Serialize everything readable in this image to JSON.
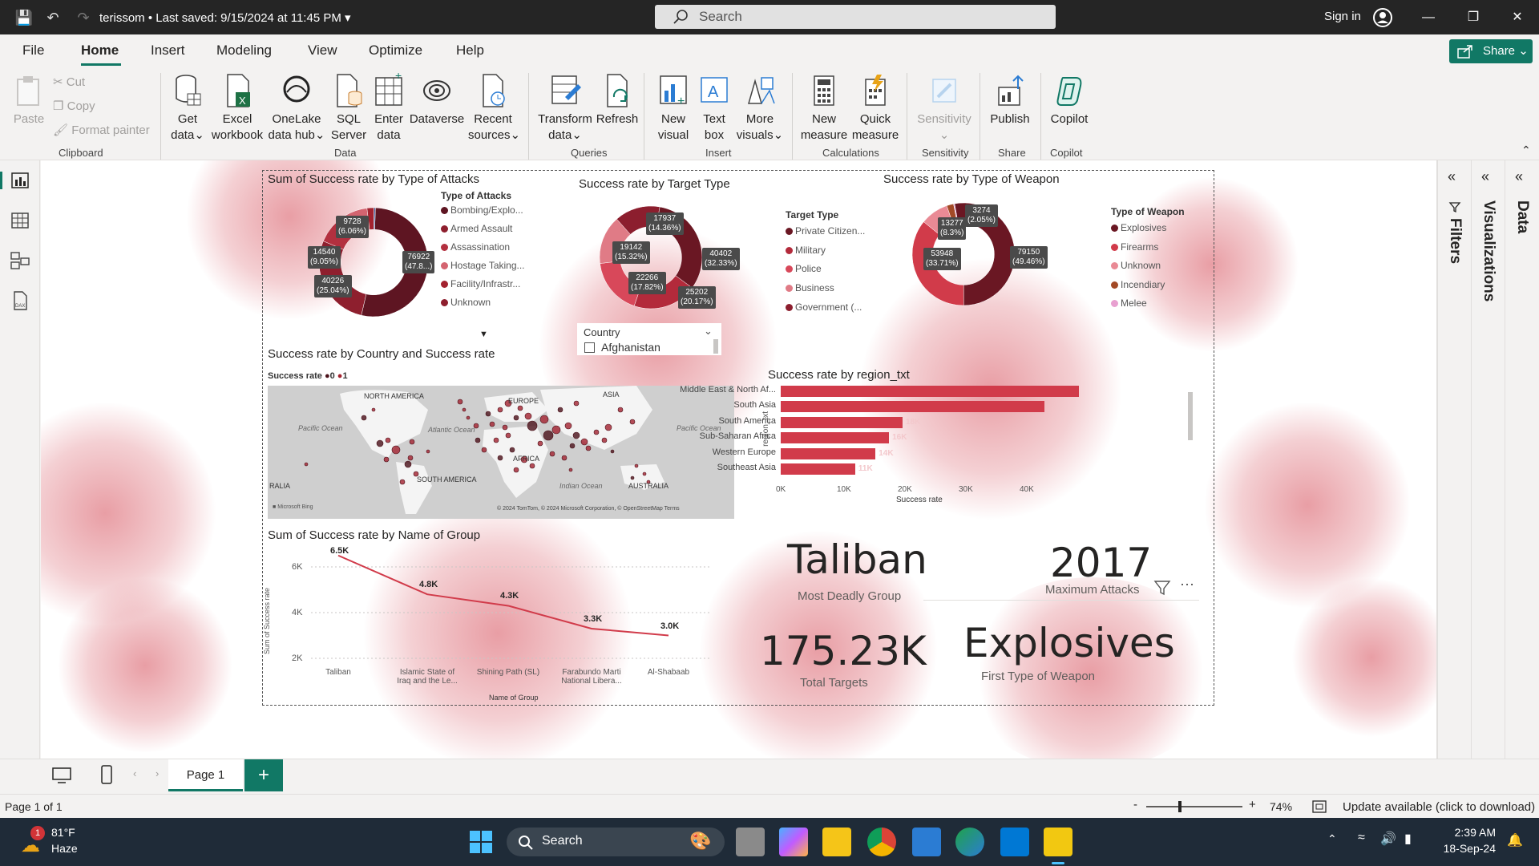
{
  "titlebar": {
    "filename": "terissom",
    "saved": "Last saved: 9/15/2024 at 11:45 PM",
    "search_placeholder": "Search",
    "signin": "Sign in"
  },
  "menu": {
    "tabs": [
      "File",
      "Home",
      "Insert",
      "Modeling",
      "View",
      "Optimize",
      "Help"
    ],
    "share": "Share"
  },
  "ribbon": {
    "clipboard": {
      "paste": "Paste",
      "cut": "Cut",
      "copy": "Copy",
      "format_painter": "Format painter",
      "group": "Clipboard"
    },
    "data": {
      "get_data": [
        "Get",
        "data"
      ],
      "excel": [
        "Excel",
        "workbook"
      ],
      "onelake": [
        "OneLake",
        "data hub"
      ],
      "sql": [
        "SQL",
        "Server"
      ],
      "enter": [
        "Enter",
        "data"
      ],
      "dataverse": "Dataverse",
      "recent": [
        "Recent",
        "sources"
      ],
      "group": "Data"
    },
    "queries": {
      "transform": [
        "Transform",
        "data"
      ],
      "refresh": "Refresh",
      "group": "Queries"
    },
    "insert": {
      "new_visual": [
        "New",
        "visual"
      ],
      "text_box": [
        "Text",
        "box"
      ],
      "more_visuals": [
        "More",
        "visuals"
      ],
      "group": "Insert"
    },
    "calculations": {
      "new_measure": [
        "New",
        "measure"
      ],
      "quick_measure": [
        "Quick",
        "measure"
      ],
      "group": "Calculations"
    },
    "sensitivity": {
      "label": "Sensitivity",
      "group": "Sensitivity"
    },
    "share": {
      "publish": "Publish",
      "group": "Share"
    },
    "copilot": {
      "label": "Copilot",
      "group": "Copilot"
    }
  },
  "visuals": {
    "attacks_donut": {
      "title": "Sum of Success rate by Type of Attacks",
      "legend_title": "Type of Attacks",
      "legend": [
        "Bombing/Explo...",
        "Armed Assault",
        "Assassination",
        "Hostage Taking...",
        "Facility/Infrastr...",
        "Unknown"
      ],
      "labels": [
        [
          "9728",
          "(6.06%)"
        ],
        [
          "14540",
          "(9.05%)"
        ],
        [
          "76922",
          "(47.8...)"
        ],
        [
          "40226",
          "(25.04%)"
        ]
      ]
    },
    "target_donut": {
      "title": "Success rate by Target Type",
      "legend_title": "Target Type",
      "legend": [
        "Private Citizen...",
        "Military",
        "Police",
        "Business",
        "Government (..."
      ],
      "labels": [
        [
          "17937",
          "(14.36%)"
        ],
        [
          "19142",
          "(15.32%)"
        ],
        [
          "40402",
          "(32.33%)"
        ],
        [
          "22266",
          "(17.82%)"
        ],
        [
          "25202",
          "(20.17%)"
        ]
      ]
    },
    "weapon_donut": {
      "title": "Success rate by Type of Weapon",
      "legend_title": "Type of Weapon",
      "legend": [
        "Explosives",
        "Firearms",
        "Unknown",
        "Incendiary",
        "Melee"
      ],
      "labels": [
        [
          "3274",
          "(2.05%)"
        ],
        [
          "13277",
          "(8.3%)"
        ],
        [
          "53948",
          "(33.71%)"
        ],
        [
          "79150",
          "(49.46%)"
        ]
      ]
    },
    "country_slicer": {
      "title": "Country",
      "item": "Afghanistan"
    },
    "map": {
      "title": "Success rate by Country and Success rate",
      "legend_label": "Success rate",
      "legend_items": [
        "0",
        "1"
      ],
      "places": [
        "NORTH AMERICA",
        "EUROPE",
        "ASIA",
        "Pacific Ocean",
        "Atlantic Ocean",
        "Pacific Ocean",
        "AFRICA",
        "SOUTH AMERICA",
        "Indian Ocean",
        "AUSTRALIA",
        "RALIA"
      ],
      "attribution": "© 2024 TomTom, © 2024 Microsoft Corporation, © OpenStreetMap  Terms",
      "bing": "Microsoft Bing"
    },
    "region_bar": {
      "title": "Success rate by region_txt",
      "y_axis": "region_txt",
      "x_axis": "Success rate",
      "ticks": [
        "0K",
        "10K",
        "20K",
        "30K",
        "40K"
      ],
      "inside_labels": [
        "",
        "",
        "18K",
        "16K",
        "14K",
        "11K"
      ]
    },
    "group_line": {
      "title": "Sum of Success rate by Name of Group",
      "y_axis": "Sum of Success rate",
      "x_axis": "Name of Group",
      "y_ticks": [
        "6K",
        "4K",
        "2K"
      ],
      "categories": [
        [
          "Taliban"
        ],
        [
          "Islamic State of",
          "Iraq and the Le..."
        ],
        [
          "Shining Path (SL)"
        ],
        [
          "Farabundo Marti",
          "National Libera..."
        ],
        [
          "Al-Shabaab"
        ]
      ],
      "labels": [
        "6.5K",
        "4.8K",
        "4.3K",
        "3.3K",
        "3.0K"
      ]
    },
    "cards": {
      "group": {
        "value": "Taliban",
        "label": "Most Deadly Group"
      },
      "attacks": {
        "value": "2017",
        "label": "Maximum Attacks"
      },
      "targets": {
        "value": "175.23K",
        "label": "Total Targets"
      },
      "weapon": {
        "value": "Explosives",
        "label": "First Type of Weapon"
      }
    }
  },
  "panes": {
    "filters": "Filters",
    "visualizations": "Visualizations",
    "data": "Data"
  },
  "pages": {
    "tab": "Page 1"
  },
  "status": {
    "page": "Page 1 of 1",
    "zoom": "74%",
    "update": "Update available (click to download)"
  },
  "taskbar": {
    "weather_temp": "81°F",
    "weather_desc": "Haze",
    "weather_badge": "1",
    "search": "Search",
    "time": "2:39 AM",
    "date": "18-Sep-24"
  },
  "chart_data": [
    {
      "type": "pie",
      "title": "Sum of Success rate by Type of Attacks",
      "categories": [
        "Bombing/Explo...",
        "Armed Assault",
        "Assassination",
        "Hostage Taking...",
        "Facility/Infrastr...",
        "Unknown"
      ],
      "values": [
        76922,
        40226,
        14540,
        9728,
        3000,
        600
      ],
      "colors": [
        "#5e1522",
        "#8e1f2e",
        "#b3303f",
        "#d46470",
        "#a3222f",
        "#3d5a9e"
      ]
    },
    {
      "type": "pie",
      "title": "Success rate by Target Type",
      "categories": [
        "Private Citizen...",
        "Military",
        "Police",
        "Business",
        "Government (..."
      ],
      "values": [
        40402,
        25202,
        22266,
        19142,
        17937
      ],
      "colors": [
        "#6a1723",
        "#b32a3b",
        "#d8485a",
        "#e07b86",
        "#8c1e2e"
      ]
    },
    {
      "type": "pie",
      "title": "Success rate by Type of Weapon",
      "categories": [
        "Explosives",
        "Firearms",
        "Unknown",
        "Incendiary",
        "Melee"
      ],
      "values": [
        79150,
        53948,
        13277,
        3274,
        500
      ],
      "colors": [
        "#6a1723",
        "#d13b4a",
        "#e98a95",
        "#a34a26",
        "#e8a0d0"
      ]
    },
    {
      "type": "bar",
      "title": "Success rate by region_txt",
      "categories": [
        "Middle East & North Af...",
        "South Asia",
        "South America",
        "Sub-Saharan Africa",
        "Western Europe",
        "Southeast Asia"
      ],
      "values": [
        44000,
        39000,
        18000,
        16000,
        14000,
        11000
      ],
      "xlabel": "Success rate",
      "ylabel": "region_txt",
      "xlim": [
        0,
        45000
      ]
    },
    {
      "type": "line",
      "title": "Sum of Success rate by Name of Group",
      "categories": [
        "Taliban",
        "Islamic State of Iraq and the Le...",
        "Shining Path (SL)",
        "Farabundo Marti National Libera...",
        "Al-Shabaab"
      ],
      "values": [
        6500,
        4800,
        4300,
        3300,
        3000
      ],
      "xlabel": "Name of Group",
      "ylabel": "Sum of Success rate",
      "ylim": [
        2000,
        6500
      ]
    }
  ]
}
